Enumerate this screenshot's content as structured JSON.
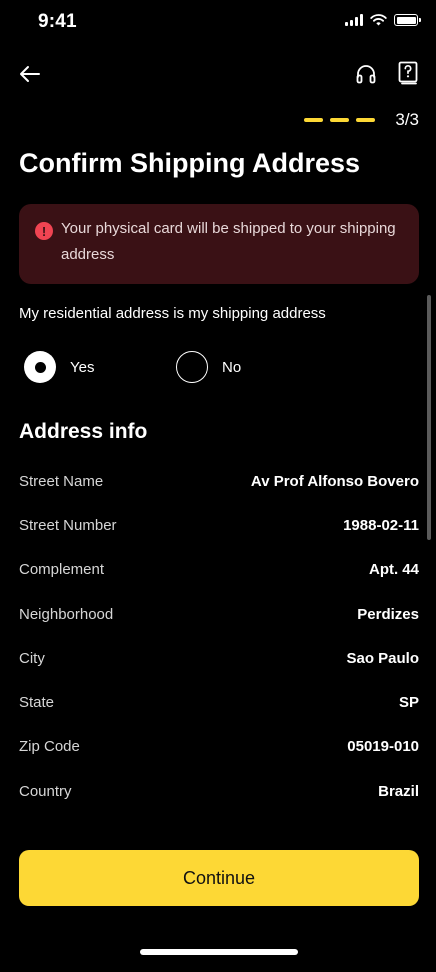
{
  "status_bar": {
    "time": "9:41"
  },
  "progress": {
    "step_label": "3/3",
    "color": "#FDD835"
  },
  "page": {
    "title": "Confirm Shipping Address"
  },
  "alert": {
    "message": "Your physical card will be shipped to your shipping address",
    "icon": "exclamation-icon",
    "color": "#F04452"
  },
  "residential_question": {
    "label": "My residential address is my shipping address",
    "options": [
      {
        "label": "Yes",
        "selected": true
      },
      {
        "label": "No",
        "selected": false
      }
    ]
  },
  "address_info": {
    "title": "Address info",
    "rows": [
      {
        "label": "Street Name",
        "value": "Av Prof Alfonso Bovero"
      },
      {
        "label": "Street Number",
        "value": "1988-02-11"
      },
      {
        "label": "Complement",
        "value": "Apt. 44"
      },
      {
        "label": "Neighborhood",
        "value": "Perdizes"
      },
      {
        "label": "City",
        "value": "Sao Paulo"
      },
      {
        "label": "State",
        "value": "SP"
      },
      {
        "label": "Zip Code",
        "value": "05019-010"
      },
      {
        "label": "Country",
        "value": "Brazil"
      }
    ]
  },
  "footer": {
    "continue_label": "Continue",
    "accent": "#FDD835"
  }
}
